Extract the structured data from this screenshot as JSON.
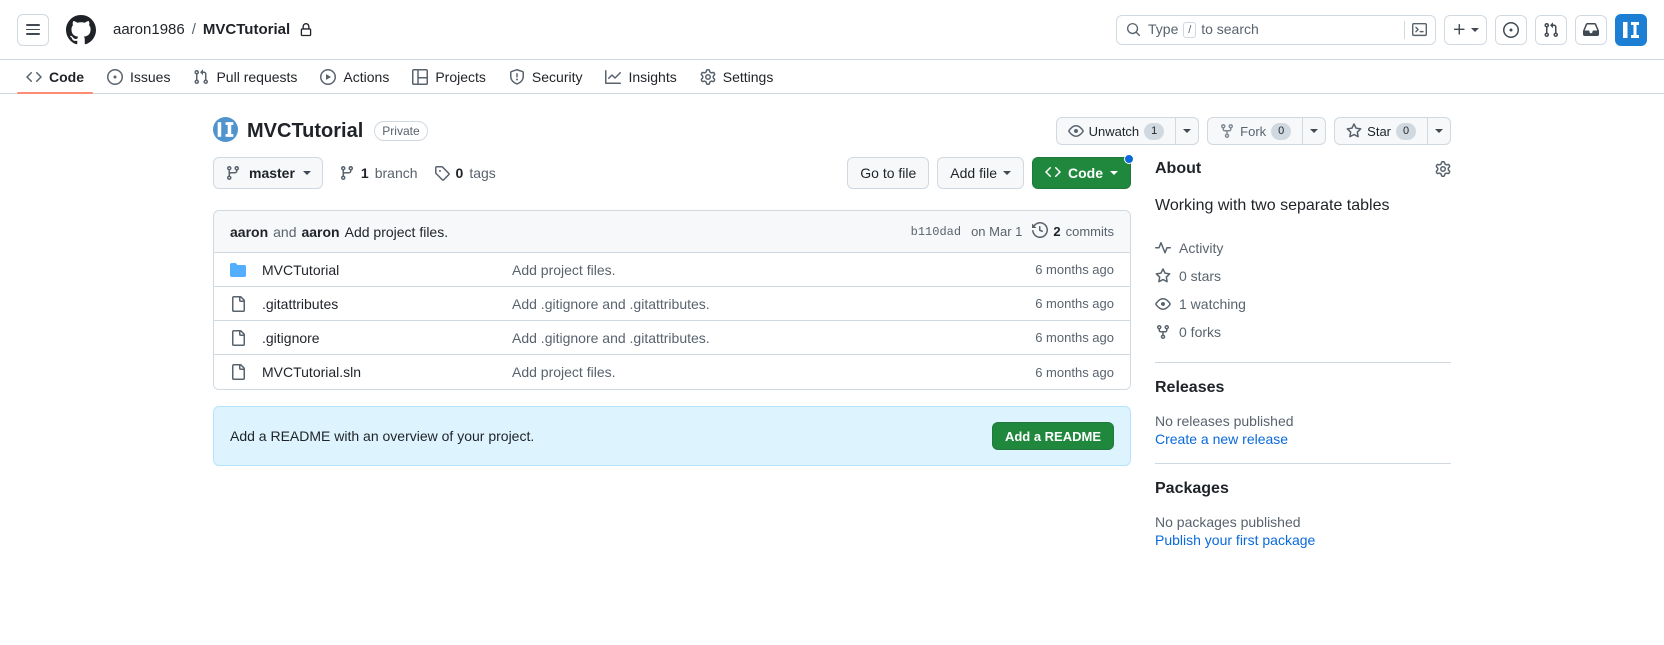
{
  "header": {
    "menu_label": "Open menu",
    "logo_name": "github-logo",
    "owner": "aaron1986",
    "separator": "/",
    "repo": "MVCTutorial",
    "visibility_icon": "lock-icon",
    "search": {
      "placeholder_prefix": "Type",
      "placeholder_key": "/",
      "placeholder_suffix": "to search"
    },
    "create_new_label": "+",
    "issues_icon": "issue-opened-icon",
    "pulls_icon": "git-pull-request-icon",
    "inbox_icon": "inbox-icon",
    "avatar_name": "user-avatar"
  },
  "repo_nav": [
    {
      "label": "Code",
      "icon": "code-icon",
      "active": true
    },
    {
      "label": "Issues",
      "icon": "issue-opened-icon",
      "active": false
    },
    {
      "label": "Pull requests",
      "icon": "git-pull-request-icon",
      "active": false
    },
    {
      "label": "Actions",
      "icon": "play-icon",
      "active": false
    },
    {
      "label": "Projects",
      "icon": "table-icon",
      "active": false
    },
    {
      "label": "Security",
      "icon": "shield-icon",
      "active": false
    },
    {
      "label": "Insights",
      "icon": "graph-icon",
      "active": false
    },
    {
      "label": "Settings",
      "icon": "gear-icon",
      "active": false
    }
  ],
  "repo": {
    "icon": "repo-avatar-icon",
    "name": "MVCTutorial",
    "visibility": "Private",
    "watch": {
      "label": "Unwatch",
      "count": "1",
      "icon": "eye-icon"
    },
    "fork": {
      "label": "Fork",
      "count": "0",
      "icon": "repo-forked-icon"
    },
    "star": {
      "label": "Star",
      "count": "0",
      "icon": "star-icon"
    }
  },
  "toolbar": {
    "branch": "master",
    "branch_icon": "git-branch-icon",
    "branches_count": "1",
    "branches_label": "branch",
    "tags_count": "0",
    "tags_label": "tags",
    "tags_icon": "tag-icon",
    "go_to_file": "Go to file",
    "add_file": "Add file",
    "code_label": "Code",
    "code_icon": "code-icon"
  },
  "commit_bar": {
    "author_primary": "aaron",
    "conjunction": "and",
    "author_secondary": "aaron",
    "message": "Add project files.",
    "sha": "b110dad",
    "date": "on Mar 1",
    "history_icon": "history-icon",
    "commits_count": "2",
    "commits_label": "commits"
  },
  "files": [
    {
      "icon": "folder-icon",
      "type": "folder",
      "name": "MVCTutorial",
      "message": "Add project files.",
      "age": "6 months ago"
    },
    {
      "icon": "file-icon",
      "type": "file",
      "name": ".gitattributes",
      "message": "Add .gitignore and .gitattributes.",
      "age": "6 months ago"
    },
    {
      "icon": "file-icon",
      "type": "file",
      "name": ".gitignore",
      "message": "Add .gitignore and .gitattributes.",
      "age": "6 months ago"
    },
    {
      "icon": "file-icon",
      "type": "file",
      "name": "MVCTutorial.sln",
      "message": "Add project files.",
      "age": "6 months ago"
    }
  ],
  "readme_banner": {
    "text": "Add a README with an overview of your project.",
    "button": "Add a README"
  },
  "sidebar": {
    "about": {
      "title": "About",
      "settings_icon": "gear-icon",
      "description": "Working with two separate tables",
      "stats": [
        {
          "icon": "pulse-icon",
          "label": "Activity"
        },
        {
          "icon": "star-icon",
          "label": "0 stars"
        },
        {
          "icon": "eye-icon",
          "label": "1 watching"
        },
        {
          "icon": "repo-forked-icon",
          "label": "0 forks"
        }
      ]
    },
    "releases": {
      "title": "Releases",
      "empty": "No releases published",
      "link": "Create a new release"
    },
    "packages": {
      "title": "Packages",
      "empty": "No packages published",
      "link": "Publish your first package"
    }
  },
  "colors": {
    "accent": "#0969da",
    "green": "#1f883d",
    "active_tab": "#fd8c73",
    "border": "#d1d9e0",
    "muted": "#59636e"
  }
}
